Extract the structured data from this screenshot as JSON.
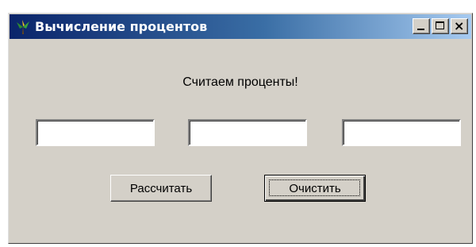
{
  "window": {
    "title": "Вычисление процентов",
    "app_icon": "tree-app-icon",
    "controls": {
      "minimize_icon": "minimize-icon",
      "maximize_icon": "maximize-icon",
      "close_icon": "close-icon",
      "close_glyph": "×"
    }
  },
  "main": {
    "heading": "Считаем проценты!",
    "inputs": [
      {
        "value": "",
        "placeholder": ""
      },
      {
        "value": "",
        "placeholder": ""
      },
      {
        "value": "",
        "placeholder": ""
      }
    ],
    "buttons": {
      "calculate": "Рассчитать",
      "clear": "Очистить"
    }
  },
  "colors": {
    "face": "#d4d0c8",
    "title_gradient_start": "#0a246a",
    "title_gradient_end": "#a6caf0"
  }
}
